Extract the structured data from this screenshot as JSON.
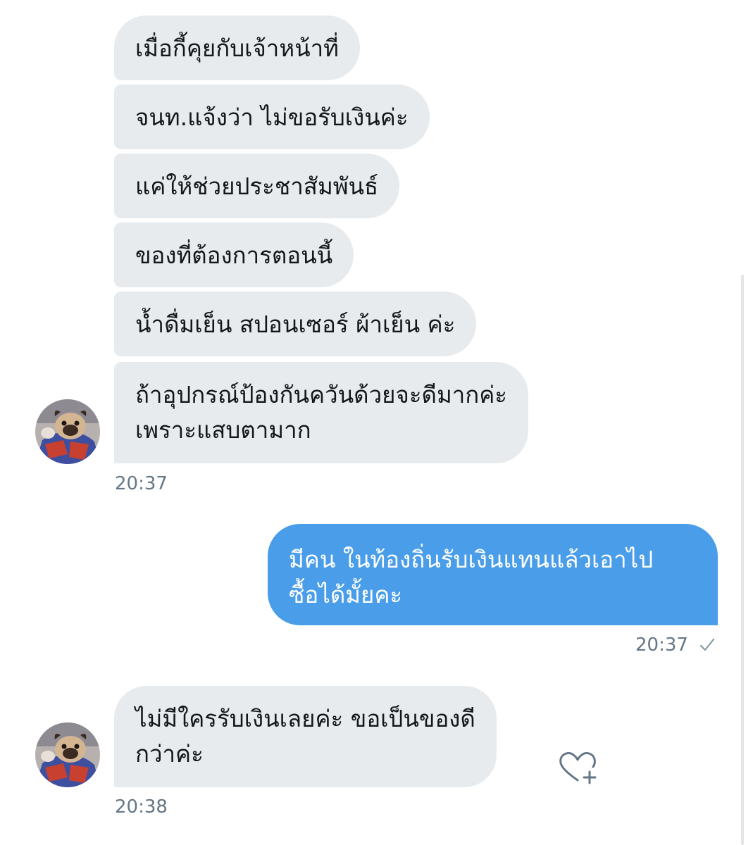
{
  "conversation": {
    "received_1": [
      {
        "text": "เมื่อกี้คุยกับเจ้าหน้าที่"
      },
      {
        "text": "จนท.แจ้งว่า ไม่ขอรับเงินค่ะ"
      },
      {
        "text": "แค่ให้ช่วยประชาสัมพันธ์"
      },
      {
        "text": "ของที่ต้องการตอนนี้"
      },
      {
        "text": "น้ำดื่มเย็น สปอนเซอร์ ผ้าเย็น ค่ะ"
      },
      {
        "line1": "ถ้าอุปกรณ์ป้องกันควันด้วยจะดีมากค่ะ",
        "line2": "เพราะแสบตามาก"
      }
    ],
    "received_1_time": "20:37",
    "sent": {
      "line1": "มีคน ในท้องถิ่นรับเงินแทนแล้วเอาไป",
      "line2": "ซื้อได้มั้ยคะ"
    },
    "sent_time": "20:37",
    "received_2": {
      "line1": "ไม่มีใครรับเงินเลยค่ะ ขอเป็นของดี",
      "line2": "กว่าค่ะ"
    },
    "received_2_time": "20:38"
  },
  "icons": {
    "avatar": "pug-avatar",
    "sent_status": "check-icon",
    "react": "heart-plus-icon"
  },
  "colors": {
    "incoming_bubble": "#e8ebee",
    "outgoing_bubble": "#4a9de8",
    "timestamp": "#657786",
    "text": "#14171a"
  }
}
